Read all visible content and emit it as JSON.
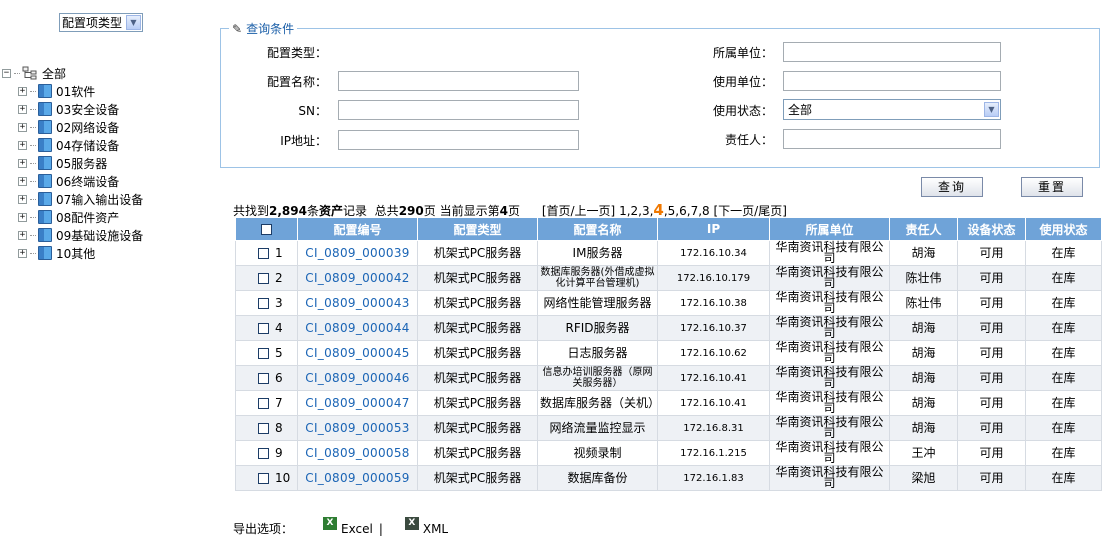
{
  "sidebar": {
    "type_select": "配置项类型",
    "root_label": "全部",
    "items": [
      {
        "label": "01软件"
      },
      {
        "label": "03安全设备"
      },
      {
        "label": "02网络设备"
      },
      {
        "label": "04存储设备"
      },
      {
        "label": "05服务器"
      },
      {
        "label": "06终端设备"
      },
      {
        "label": "07输入输出设备"
      },
      {
        "label": "08配件资产"
      },
      {
        "label": "09基础设施设备"
      },
      {
        "label": "10其他"
      }
    ]
  },
  "query": {
    "legend": "查询条件",
    "config_type_label": "配置类型：",
    "config_name_label": "配置名称：",
    "sn_label": "SN：",
    "ip_label": "IP地址：",
    "owner_unit_label": "所属单位：",
    "use_unit_label": "使用单位：",
    "use_status_label": "使用状态：",
    "use_status_value": "全部",
    "responsible_label": "责任人："
  },
  "buttons": {
    "search": "查询",
    "reset": "重置"
  },
  "summary": {
    "found_prefix": "共找到",
    "count": "2,894",
    "unit": "条",
    "entity": "资产",
    "record": "记录",
    "total_prefix": "总共",
    "total_pages": "290",
    "page_word": "页",
    "current_prefix": "当前显示第",
    "current_page": "4",
    "pager_left": "[首页/上一页]",
    "pager_before": "1,2,3,",
    "pager_current": "4",
    "pager_after": ",5,6,7,8",
    "pager_right": "[下一页/尾页]"
  },
  "table": {
    "columns": [
      "配置编号",
      "配置类型",
      "配置名称",
      "IP",
      "所属单位",
      "责任人",
      "设备状态",
      "使用状态"
    ],
    "rows": [
      {
        "num": "1",
        "code": "CI_0809_000039",
        "type": "机架式PC服务器",
        "name": "IM服务器",
        "ip": "172.16.10.34",
        "unit": "华南资讯科技有限公司",
        "person": "胡海",
        "dev_status": "可用",
        "use_status": "在库"
      },
      {
        "num": "2",
        "code": "CI_0809_000042",
        "type": "机架式PC服务器",
        "name": "数据库服务器(外借成虚拟化计算平台管理机)",
        "ip": "172.16.10.179",
        "unit": "华南资讯科技有限公司",
        "person": "陈壮伟",
        "dev_status": "可用",
        "use_status": "在库"
      },
      {
        "num": "3",
        "code": "CI_0809_000043",
        "type": "机架式PC服务器",
        "name": "网络性能管理服务器",
        "ip": "172.16.10.38",
        "unit": "华南资讯科技有限公司",
        "person": "陈壮伟",
        "dev_status": "可用",
        "use_status": "在库"
      },
      {
        "num": "4",
        "code": "CI_0809_000044",
        "type": "机架式PC服务器",
        "name": "RFID服务器",
        "ip": "172.16.10.37",
        "unit": "华南资讯科技有限公司",
        "person": "胡海",
        "dev_status": "可用",
        "use_status": "在库"
      },
      {
        "num": "5",
        "code": "CI_0809_000045",
        "type": "机架式PC服务器",
        "name": "日志服务器",
        "ip": "172.16.10.62",
        "unit": "华南资讯科技有限公司",
        "person": "胡海",
        "dev_status": "可用",
        "use_status": "在库"
      },
      {
        "num": "6",
        "code": "CI_0809_000046",
        "type": "机架式PC服务器",
        "name": "信息办培训服务器（原网关服务器）",
        "ip": "172.16.10.41",
        "unit": "华南资讯科技有限公司",
        "person": "胡海",
        "dev_status": "可用",
        "use_status": "在库"
      },
      {
        "num": "7",
        "code": "CI_0809_000047",
        "type": "机架式PC服务器",
        "name": "数据库服务器（关机）",
        "ip": "172.16.10.41",
        "unit": "华南资讯科技有限公司",
        "person": "胡海",
        "dev_status": "可用",
        "use_status": "在库"
      },
      {
        "num": "8",
        "code": "CI_0809_000053",
        "type": "机架式PC服务器",
        "name": "网络流量监控显示",
        "ip": "172.16.8.31",
        "unit": "华南资讯科技有限公司",
        "person": "胡海",
        "dev_status": "可用",
        "use_status": "在库"
      },
      {
        "num": "9",
        "code": "CI_0809_000058",
        "type": "机架式PC服务器",
        "name": "视频录制",
        "ip": "172.16.1.215",
        "unit": "华南资讯科技有限公司",
        "person": "王冲",
        "dev_status": "可用",
        "use_status": "在库"
      },
      {
        "num": "10",
        "code": "CI_0809_000059",
        "type": "机架式PC服务器",
        "name": "数据库备份",
        "ip": "172.16.1.83",
        "unit": "华南资讯科技有限公司",
        "person": "梁旭",
        "dev_status": "可用",
        "use_status": "在库"
      }
    ]
  },
  "export": {
    "label": "导出选项：",
    "excel": "Excel",
    "separator": "|",
    "xml": "XML"
  }
}
